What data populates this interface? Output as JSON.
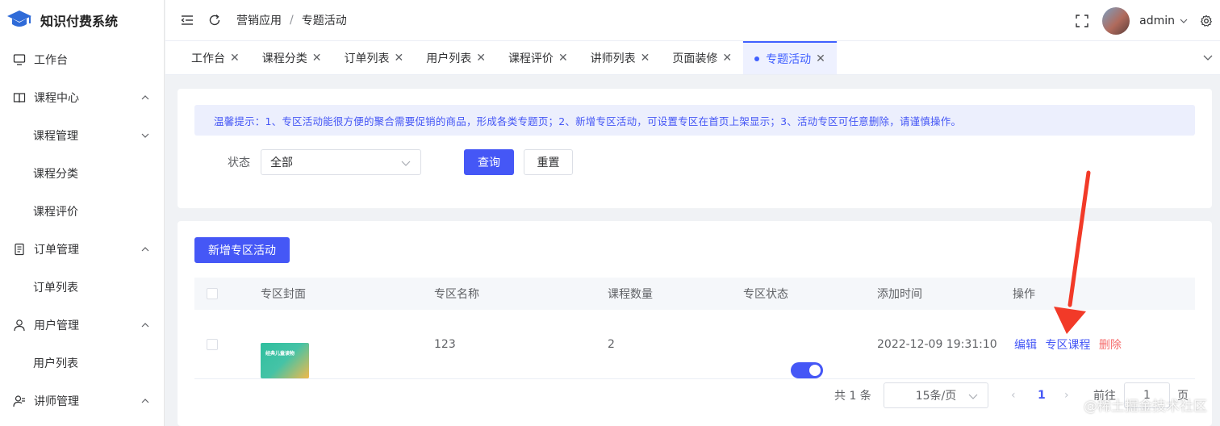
{
  "app": {
    "title": "知识付费系统"
  },
  "sidebar": {
    "items": [
      {
        "label": "工作台",
        "icon": "monitor-icon",
        "type": "top"
      },
      {
        "label": "课程中心",
        "icon": "book-icon",
        "type": "group",
        "expanded": true
      },
      {
        "label": "课程管理",
        "type": "sub-group",
        "expanded": false
      },
      {
        "label": "课程分类",
        "type": "sub"
      },
      {
        "label": "课程评价",
        "type": "sub"
      },
      {
        "label": "订单管理",
        "icon": "document-icon",
        "type": "group",
        "expanded": true
      },
      {
        "label": "订单列表",
        "type": "sub"
      },
      {
        "label": "用户管理",
        "icon": "user-icon",
        "type": "group",
        "expanded": true
      },
      {
        "label": "用户列表",
        "type": "sub"
      },
      {
        "label": "讲师管理",
        "icon": "teacher-icon",
        "type": "group",
        "expanded": true
      }
    ]
  },
  "header": {
    "breadcrumb": [
      "营销应用",
      "专题活动"
    ],
    "username": "admin"
  },
  "tabs": [
    {
      "label": "工作台",
      "active": false
    },
    {
      "label": "课程分类",
      "active": false
    },
    {
      "label": "订单列表",
      "active": false
    },
    {
      "label": "用户列表",
      "active": false
    },
    {
      "label": "课程评价",
      "active": false
    },
    {
      "label": "讲师列表",
      "active": false
    },
    {
      "label": "页面装修",
      "active": false
    },
    {
      "label": "专题活动",
      "active": true
    }
  ],
  "tip": {
    "text": "温馨提示：1、专区活动能很方便的聚合需要促销的商品，形成各类专题页；2、新增专区活动，可设置专区在首页上架显示；3、活动专区可任意删除，请谨慎操作。"
  },
  "filter": {
    "status_label": "状态",
    "status_value": "全部",
    "search_label": "查询",
    "reset_label": "重置"
  },
  "toolbar": {
    "add_label": "新增专区活动"
  },
  "table": {
    "columns": [
      "专区封面",
      "专区名称",
      "课程数量",
      "专区状态",
      "添加时间",
      "操作"
    ],
    "rows": [
      {
        "cover_text": "经典儿童读物",
        "name": "123",
        "course_count": "2",
        "status_on": true,
        "added_time": "2022-12-09 19:31:10",
        "actions": {
          "edit": "编辑",
          "courses": "专区课程",
          "delete": "删除"
        }
      }
    ]
  },
  "pagination": {
    "total": "共 1 条",
    "page_size": "15条/页",
    "current_page": "1",
    "goto_label": "前往",
    "goto_value": "1",
    "page_suffix": "页"
  },
  "watermark": "@稀土掘金技术社区",
  "colors": {
    "primary": "#4557f6",
    "danger": "#f56c6c",
    "annotation": "#f23a28"
  }
}
